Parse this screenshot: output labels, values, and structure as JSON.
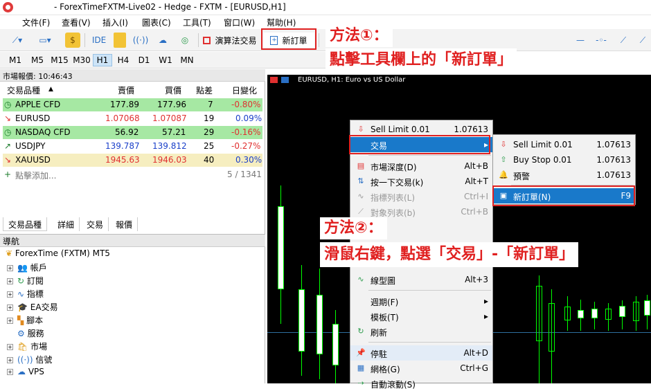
{
  "titlebar": {
    "title": "- ForexTimeFXTM-Live02 - Hedge - FXTM - [EURUSD,H1]"
  },
  "menu": [
    "文件(F)",
    "查看(V)",
    "插入(I)",
    "圖表(C)",
    "工具(T)",
    "窗口(W)",
    "幫助(H)"
  ],
  "toolbar": {
    "ide": "IDE",
    "algo": "演算法交易",
    "new_order": "新訂單"
  },
  "timeframes": [
    "M1",
    "M5",
    "M15",
    "M30",
    "H1",
    "H4",
    "D1",
    "W1",
    "MN"
  ],
  "market_watch": {
    "header": "市場報價: 10:46:43",
    "columns": [
      "交易品種",
      "賣價",
      "買價",
      "點差",
      "日變化"
    ],
    "rows": [
      {
        "symbol": "APPLE CFD",
        "bid": "177.89",
        "ask": "177.96",
        "spread": "7",
        "change": "-0.80%"
      },
      {
        "symbol": "EURUSD",
        "bid": "1.07068",
        "ask": "1.07087",
        "spread": "19",
        "change": "0.09%"
      },
      {
        "symbol": "NASDAQ CFD",
        "bid": "56.92",
        "ask": "57.21",
        "spread": "29",
        "change": "-0.16%"
      },
      {
        "symbol": "USDJPY",
        "bid": "139.787",
        "ask": "139.812",
        "spread": "25",
        "change": "-0.27%"
      },
      {
        "symbol": "XAUUSD",
        "bid": "1945.63",
        "ask": "1946.03",
        "spread": "40",
        "change": "0.30%"
      }
    ],
    "add_label": "點擊添加...",
    "count": "5 / 1341",
    "tabs": [
      "交易品種",
      "詳細",
      "交易",
      "報價"
    ]
  },
  "navigator": {
    "header": "導航",
    "root": "ForexTime (FXTM) MT5",
    "items": [
      "帳戶",
      "訂閱",
      "指標",
      "EA交易",
      "腳本",
      "服務",
      "市場",
      "信號",
      "VPS"
    ]
  },
  "chart": {
    "header": "EURUSD, H1:  Euro vs US Dollar"
  },
  "context_menu": {
    "items": [
      {
        "label": "Sell Limit 0.01",
        "shortcut": "1.07613"
      },
      {
        "label": "交易",
        "shortcut": ""
      },
      {
        "label": "市場深度(D)",
        "shortcut": "Alt+B"
      },
      {
        "label": "按一下交易(k)",
        "shortcut": "Alt+T"
      },
      {
        "label": "指標列表(L)",
        "shortcut": "Ctrl+I"
      },
      {
        "label": "對象列表(b)",
        "shortcut": "Ctrl+B"
      },
      {
        "label": "線型圖",
        "shortcut": "Alt+3"
      },
      {
        "label": "週期(F)",
        "shortcut": ""
      },
      {
        "label": "模板(T)",
        "shortcut": ""
      },
      {
        "label": "刷新",
        "shortcut": ""
      },
      {
        "label": "停駐",
        "shortcut": "Alt+D"
      },
      {
        "label": "網格(G)",
        "shortcut": "Ctrl+G"
      },
      {
        "label": "自動滾動(S)",
        "shortcut": ""
      }
    ]
  },
  "submenu": {
    "items": [
      {
        "label": "Sell Limit 0.01",
        "shortcut": "1.07613"
      },
      {
        "label": "Buy Stop 0.01",
        "shortcut": "1.07613"
      },
      {
        "label": "預警",
        "shortcut": "1.07613"
      },
      {
        "label": "新訂單(N)",
        "shortcut": "F9"
      }
    ]
  },
  "annotations": {
    "method1_title": "方法①：",
    "method1_text": "點擊工具欄上的「新訂單」",
    "method2_title": "方法②：",
    "method2_text": "滑鼠右鍵，點選「交易」-「新訂單」"
  },
  "colors": {
    "accent": "#1979ca",
    "annotation": "#e02020",
    "candle": "#00ff00"
  }
}
